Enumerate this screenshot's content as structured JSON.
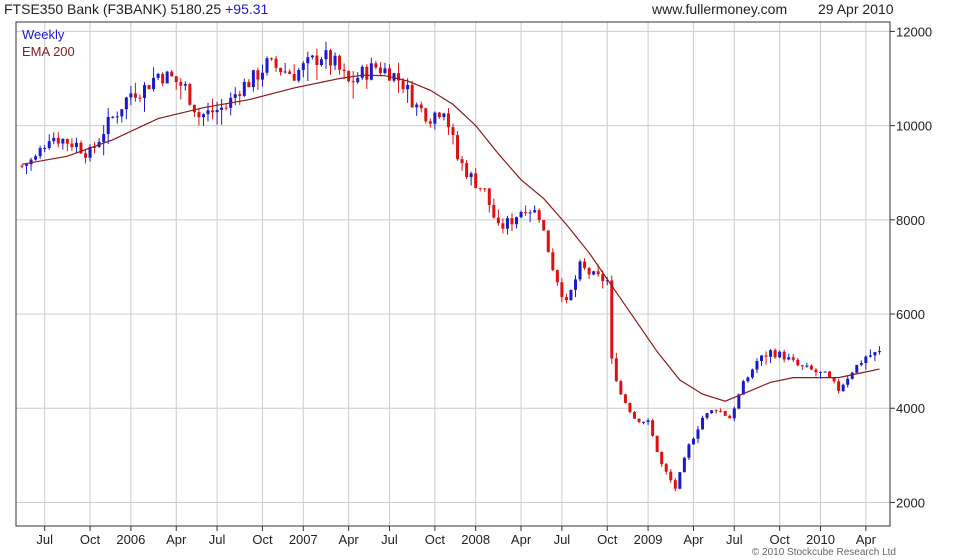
{
  "header": {
    "instrument": "FTSE350 Bank (F3BANK) 5180.25",
    "change": "+95.31",
    "site": "www.fullermoney.com",
    "date": "29 Apr 2010"
  },
  "legend": {
    "series1": "Weekly",
    "series2": "EMA 200"
  },
  "copyright": "© 2010 Stockcube Research Ltd",
  "colors": {
    "up": "#1a1acc",
    "down": "#dd1111",
    "ema": "#8b1a1a",
    "grid": "#cccccc",
    "axis": "#333333"
  },
  "chart_data": {
    "type": "candlestick",
    "ylim": [
      1500,
      12200
    ],
    "yticks": [
      2000,
      4000,
      6000,
      8000,
      10000,
      12000
    ],
    "xlim": [
      0,
      190
    ],
    "xticks": [
      {
        "label": "Jul",
        "x": 5
      },
      {
        "label": "Oct",
        "x": 15
      },
      {
        "label": "2006",
        "x": 24
      },
      {
        "label": "Apr",
        "x": 34
      },
      {
        "label": "Jul",
        "x": 43
      },
      {
        "label": "Oct",
        "x": 53
      },
      {
        "label": "2007",
        "x": 62
      },
      {
        "label": "Apr",
        "x": 72
      },
      {
        "label": "Jul",
        "x": 81
      },
      {
        "label": "Oct",
        "x": 91
      },
      {
        "label": "2008",
        "x": 100
      },
      {
        "label": "Apr",
        "x": 110
      },
      {
        "label": "Jul",
        "x": 119
      },
      {
        "label": "Oct",
        "x": 129
      },
      {
        "label": "2009",
        "x": 138
      },
      {
        "label": "Apr",
        "x": 148
      },
      {
        "label": "Jul",
        "x": 157
      },
      {
        "label": "Oct",
        "x": 167
      },
      {
        "label": "2010",
        "x": 176
      },
      {
        "label": "Apr",
        "x": 186
      }
    ],
    "close_path": [
      [
        0,
        9150
      ],
      [
        3,
        9300
      ],
      [
        6,
        9800
      ],
      [
        9,
        9700
      ],
      [
        12,
        9600
      ],
      [
        15,
        9400
      ],
      [
        18,
        9900
      ],
      [
        21,
        10300
      ],
      [
        24,
        10700
      ],
      [
        27,
        10800
      ],
      [
        30,
        11100
      ],
      [
        33,
        11000
      ],
      [
        36,
        10800
      ],
      [
        39,
        10200
      ],
      [
        42,
        10300
      ],
      [
        45,
        10400
      ],
      [
        48,
        10800
      ],
      [
        51,
        11000
      ],
      [
        54,
        11300
      ],
      [
        57,
        11200
      ],
      [
        60,
        11100
      ],
      [
        63,
        11300
      ],
      [
        66,
        11500
      ],
      [
        69,
        11300
      ],
      [
        72,
        10900
      ],
      [
        75,
        11100
      ],
      [
        78,
        11250
      ],
      [
        81,
        11150
      ],
      [
        84,
        10900
      ],
      [
        87,
        10400
      ],
      [
        90,
        10200
      ],
      [
        93,
        10400
      ],
      [
        96,
        9300
      ],
      [
        99,
        8900
      ],
      [
        102,
        8600
      ],
      [
        105,
        7800
      ],
      [
        108,
        8000
      ],
      [
        111,
        8300
      ],
      [
        114,
        8100
      ],
      [
        117,
        7000
      ],
      [
        120,
        6200
      ],
      [
        123,
        7000
      ],
      [
        126,
        6800
      ],
      [
        129,
        6700
      ],
      [
        130,
        5000
      ],
      [
        132,
        4300
      ],
      [
        135,
        3800
      ],
      [
        138,
        3700
      ],
      [
        141,
        2800
      ],
      [
        144,
        2300
      ],
      [
        147,
        3200
      ],
      [
        150,
        3800
      ],
      [
        153,
        4000
      ],
      [
        156,
        3800
      ],
      [
        159,
        4500
      ],
      [
        162,
        5000
      ],
      [
        165,
        5200
      ],
      [
        168,
        5100
      ],
      [
        171,
        4900
      ],
      [
        174,
        4800
      ],
      [
        177,
        4700
      ],
      [
        180,
        4400
      ],
      [
        183,
        4800
      ],
      [
        186,
        5100
      ],
      [
        189,
        5180
      ]
    ],
    "ema200": [
      [
        0,
        9180
      ],
      [
        10,
        9350
      ],
      [
        20,
        9700
      ],
      [
        30,
        10150
      ],
      [
        40,
        10380
      ],
      [
        50,
        10550
      ],
      [
        60,
        10800
      ],
      [
        70,
        11000
      ],
      [
        75,
        11070
      ],
      [
        80,
        11060
      ],
      [
        85,
        10950
      ],
      [
        90,
        10750
      ],
      [
        95,
        10450
      ],
      [
        100,
        10000
      ],
      [
        105,
        9400
      ],
      [
        110,
        8850
      ],
      [
        115,
        8450
      ],
      [
        120,
        7900
      ],
      [
        125,
        7300
      ],
      [
        130,
        6600
      ],
      [
        135,
        5900
      ],
      [
        140,
        5200
      ],
      [
        145,
        4600
      ],
      [
        150,
        4300
      ],
      [
        155,
        4150
      ],
      [
        160,
        4350
      ],
      [
        165,
        4550
      ],
      [
        170,
        4650
      ],
      [
        175,
        4650
      ],
      [
        180,
        4650
      ],
      [
        185,
        4750
      ],
      [
        189,
        4830
      ]
    ]
  }
}
